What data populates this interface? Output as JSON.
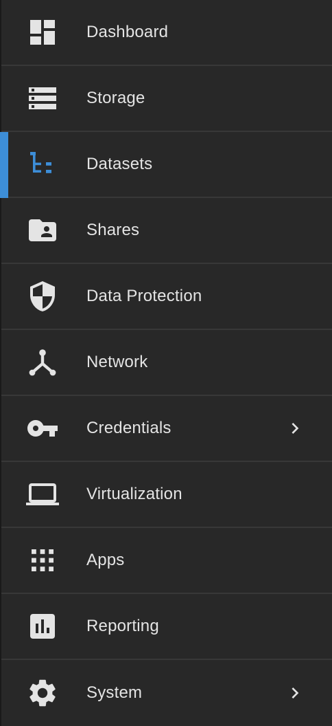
{
  "colors": {
    "background": "#282828",
    "divider": "#383838",
    "text": "#e4e4e4",
    "icon": "#e4e4e4",
    "active_accent": "#3d8ed8"
  },
  "nav": {
    "items": [
      {
        "label": "Dashboard",
        "icon": "dashboard-icon"
      },
      {
        "label": "Storage",
        "icon": "storage-icon"
      },
      {
        "label": "Datasets",
        "icon": "datasets-icon",
        "active": true
      },
      {
        "label": "Shares",
        "icon": "shares-folder-icon"
      },
      {
        "label": "Data Protection",
        "icon": "shield-icon"
      },
      {
        "label": "Network",
        "icon": "network-icon"
      },
      {
        "label": "Credentials",
        "icon": "key-icon",
        "has_submenu": true
      },
      {
        "label": "Virtualization",
        "icon": "laptop-icon"
      },
      {
        "label": "Apps",
        "icon": "apps-grid-icon"
      },
      {
        "label": "Reporting",
        "icon": "reporting-chart-icon"
      },
      {
        "label": "System",
        "icon": "gear-icon",
        "has_submenu": true
      }
    ]
  }
}
